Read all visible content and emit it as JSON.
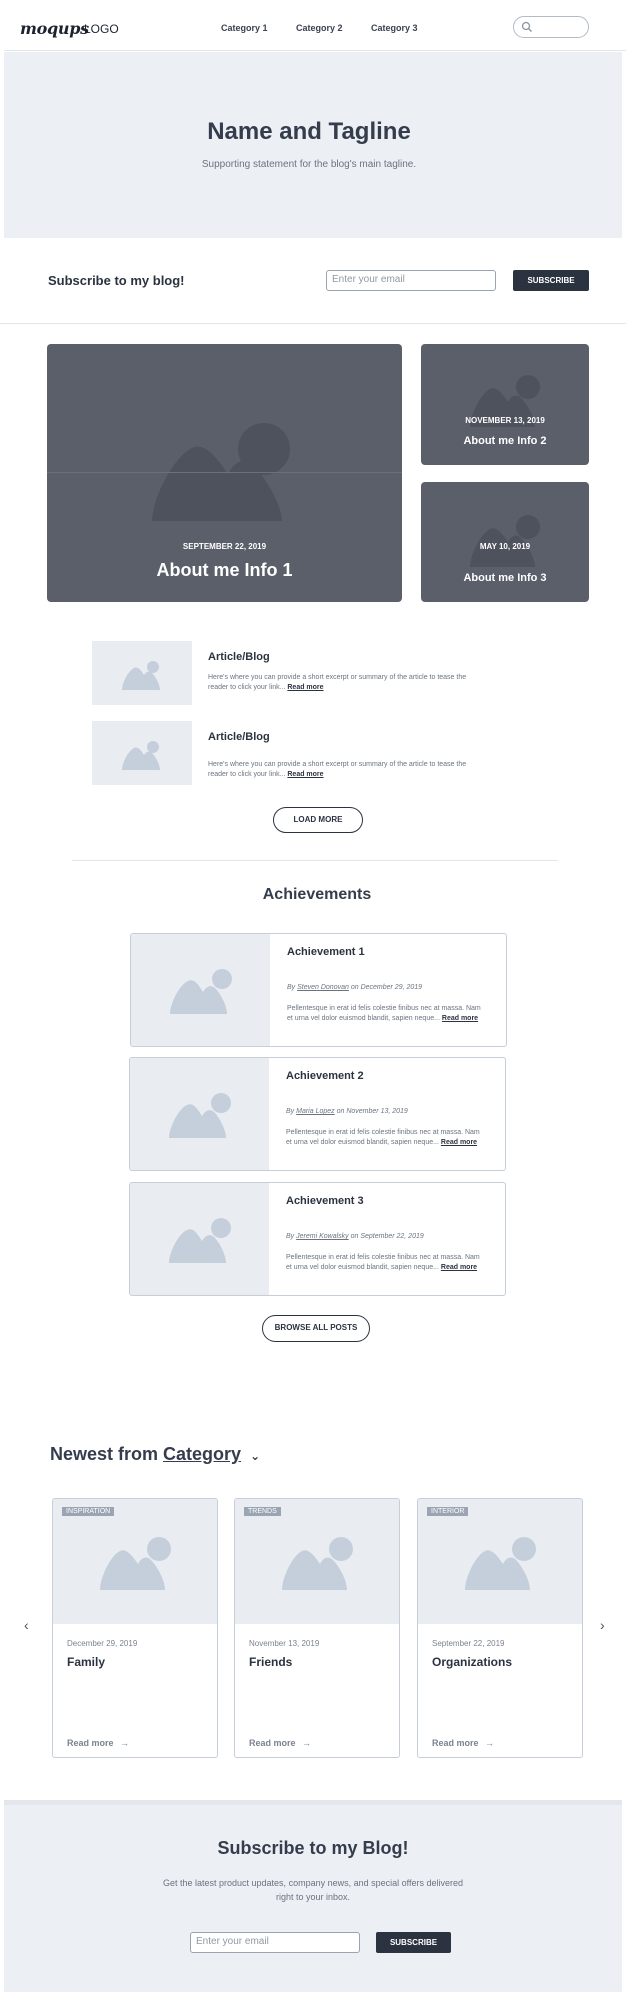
{
  "header": {
    "logo": "moqups",
    "logo_text": "LOGO",
    "nav": [
      "Category 1",
      "Category 2",
      "Category 3"
    ]
  },
  "hero": {
    "title": "Name and Tagline",
    "subtitle": "Supporting statement for the blog's main tagline."
  },
  "subscribe_bar": {
    "label": "Subscribe to my blog!",
    "placeholder": "Enter your email",
    "button": "SUBSCRIBE"
  },
  "featured": [
    {
      "date": "SEPTEMBER 22, 2019",
      "title": "About me Info 1"
    },
    {
      "date": "NOVEMBER 13, 2019",
      "title": "About me Info 2"
    },
    {
      "date": "MAY 10, 2019",
      "title": "About me Info 3"
    }
  ],
  "articles": [
    {
      "title": "Article/Blog",
      "body": "Here's where you can provide a short excerpt or summary of the article to tease the reader to click your link...",
      "read_more": "Read more"
    },
    {
      "title": "Article/Blog",
      "body": "Here's where you can provide a short excerpt or summary of the article to tease the reader to click your link...",
      "read_more": "Read more"
    }
  ],
  "load_more": "LOAD MORE",
  "achievements": {
    "heading": "Achievements",
    "items": [
      {
        "title": "Achievement 1",
        "by": "By",
        "author": "Steven Donovan",
        "on": "on December 29, 2019",
        "body": "Pellentesque in erat id felis colestie finibus nec at massa. Nam et urna vel dolor euismod blandit, sapien neque...",
        "read_more": "Read more"
      },
      {
        "title": "Achievement 2",
        "by": "By",
        "author": "Maria Lopez",
        "on": "on November 13, 2019",
        "body": "Pellentesque in erat id felis colestie finibus nec at massa. Nam et urna vel dolor euismod blandit, sapien neque...",
        "read_more": "Read more"
      },
      {
        "title": "Achievement 3",
        "by": "By",
        "author": "Jeremi Kowalsky",
        "on": "on September 22, 2019",
        "body": "Pellentesque in erat id felis colestie finibus nec at massa. Nam et urna vel dolor euismod blandit, sapien neque...",
        "read_more": "Read more"
      }
    ],
    "browse_all": "BROWSE ALL POSTS"
  },
  "newest": {
    "prefix": "Newest from",
    "category": "Category",
    "cards": [
      {
        "badge": "INSPIRATION",
        "date": "December 29, 2019",
        "title": "Family",
        "read_more": "Read more"
      },
      {
        "badge": "TRENDS",
        "date": "November 13, 2019",
        "title": "Friends",
        "read_more": "Read more"
      },
      {
        "badge": "INTERIOR",
        "date": "September 22, 2019",
        "title": "Organizations",
        "read_more": "Read more"
      }
    ]
  },
  "footer": {
    "title": "Subscribe to my Blog!",
    "text": "Get the latest product updates, company news, and special offers delivered right to your inbox.",
    "placeholder": "Enter your email",
    "button": "SUBSCRIBE"
  },
  "colors": {
    "dark": "#2b3340",
    "hero_bg": "#eceff4",
    "featured_bg": "#5a5f6a",
    "placeholder_bg": "#e9edf2",
    "placeholder_icon": "#c5cfdb"
  }
}
